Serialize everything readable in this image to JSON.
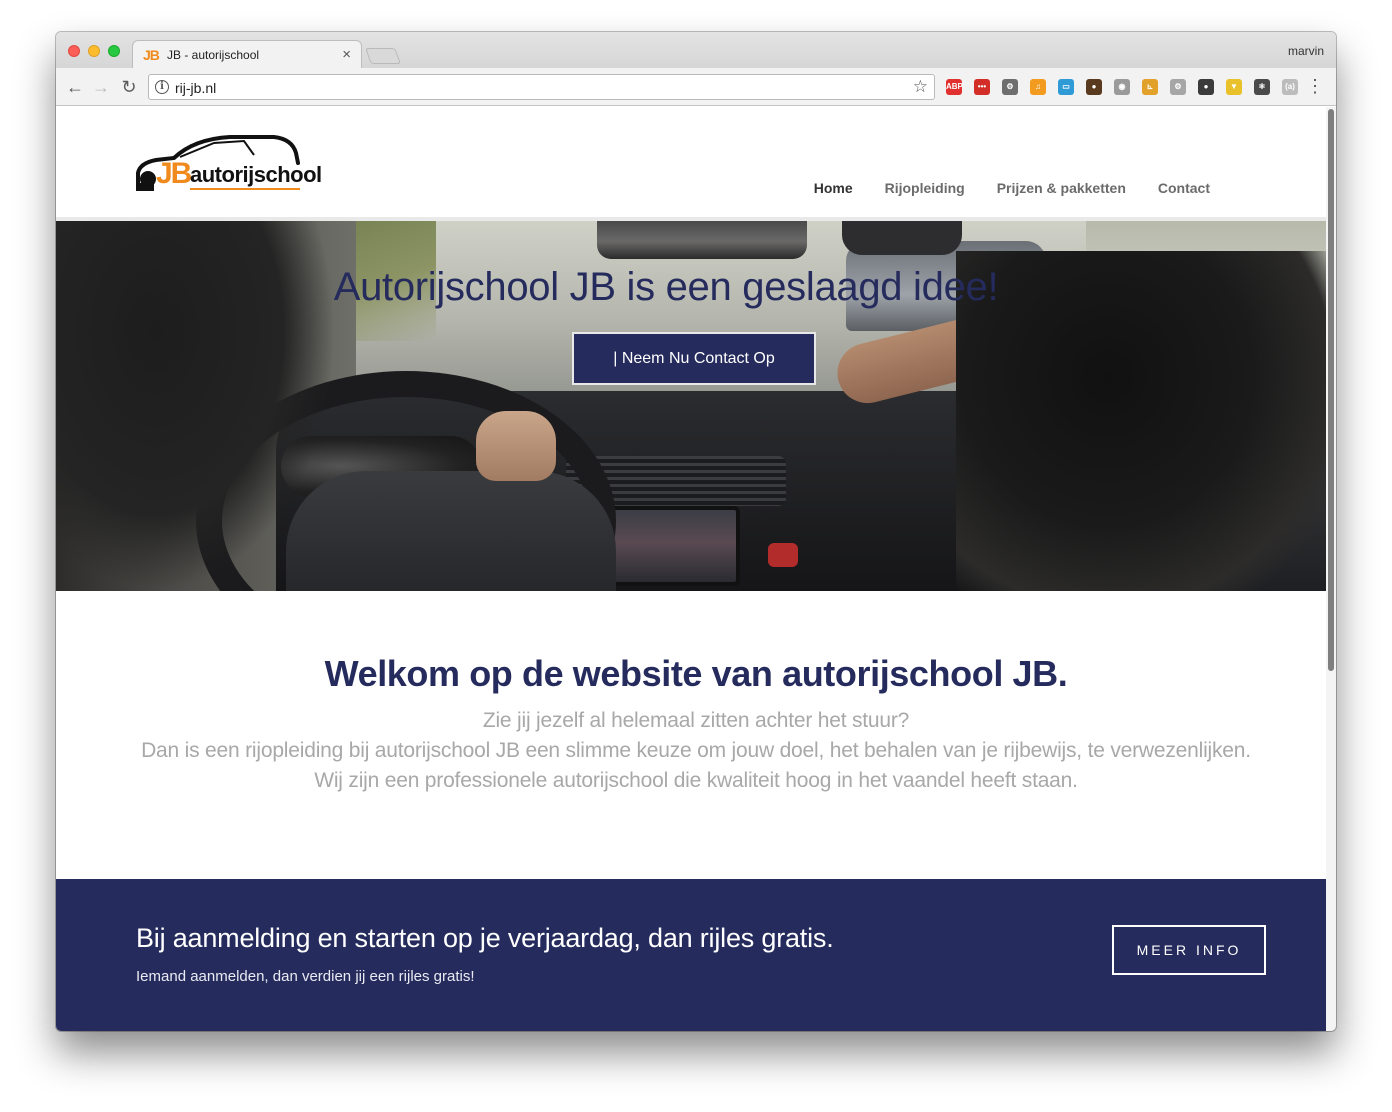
{
  "browser": {
    "tab_favicon": "JB",
    "tab_title": "JB - autorijschool",
    "tab_close": "×",
    "user_name": "marvin",
    "url": "rij-jb.nl",
    "info_glyph": "i",
    "star_glyph": "☆",
    "back_glyph": "←",
    "forward_glyph": "→",
    "reload_glyph": "↻",
    "menu_glyph": "⋮",
    "extensions": [
      {
        "name": "adblock-plus-icon",
        "label": "ABP",
        "color": "#e0302f"
      },
      {
        "name": "lastpass-icon",
        "label": "•••",
        "color": "#d32d27"
      },
      {
        "name": "settings-cog-icon",
        "label": "⚙",
        "color": "#6e6e6e"
      },
      {
        "name": "music-icon",
        "label": "♫",
        "color": "#f39b1e"
      },
      {
        "name": "window-icon",
        "label": "▭",
        "color": "#2e9bd6"
      },
      {
        "name": "spy-icon",
        "label": "●",
        "color": "#5a3a1e"
      },
      {
        "name": "camera-icon",
        "label": "◉",
        "color": "#9a9a9a"
      },
      {
        "name": "ruler-icon",
        "label": "⊾",
        "color": "#e1a12a"
      },
      {
        "name": "gear-icon",
        "label": "⚙",
        "color": "#a6a6a6"
      },
      {
        "name": "circle-icon",
        "label": "●",
        "color": "#3b3b3b"
      },
      {
        "name": "shield-icon",
        "label": "▼",
        "color": "#e9c12a"
      },
      {
        "name": "react-icon",
        "label": "⚛",
        "color": "#4a4a4a"
      },
      {
        "name": "a11y-icon",
        "label": "(a)",
        "color": "#bcbcbc"
      }
    ]
  },
  "site": {
    "logo_jb": "JB",
    "logo_word": "autorijschool",
    "nav": [
      {
        "label": "Home",
        "active": true
      },
      {
        "label": "Rijopleiding",
        "active": false
      },
      {
        "label": "Prijzen & pakketten",
        "active": false
      },
      {
        "label": "Contact",
        "active": false
      }
    ],
    "hero": {
      "title": "Autorijschool JB is een geslaagd idee!",
      "cta": "| Neem Nu Contact Op"
    },
    "welcome": {
      "title": "Welkom op de website van autorijschool JB.",
      "line1": "Zie jij jezelf al helemaal zitten achter het stuur?",
      "line2": "Dan is een rijopleiding bij autorijschool JB een slimme keuze om jouw doel, het behalen van je rijbewijs, te verwezenlijken.",
      "line3": "Wij zijn een professionele autorijschool die kwaliteit hoog in het vaandel heeft staan."
    },
    "promo": {
      "title": "Bij aanmelding en starten op je verjaardag, dan rijles gratis.",
      "subtitle": "Iemand aanmelden, dan verdien jij een rijles gratis!",
      "button": "MEER INFO"
    }
  },
  "colors": {
    "brand_navy": "#252b5c",
    "brand_orange": "#f08a1c",
    "welcome_text": "#a8a8a8"
  }
}
